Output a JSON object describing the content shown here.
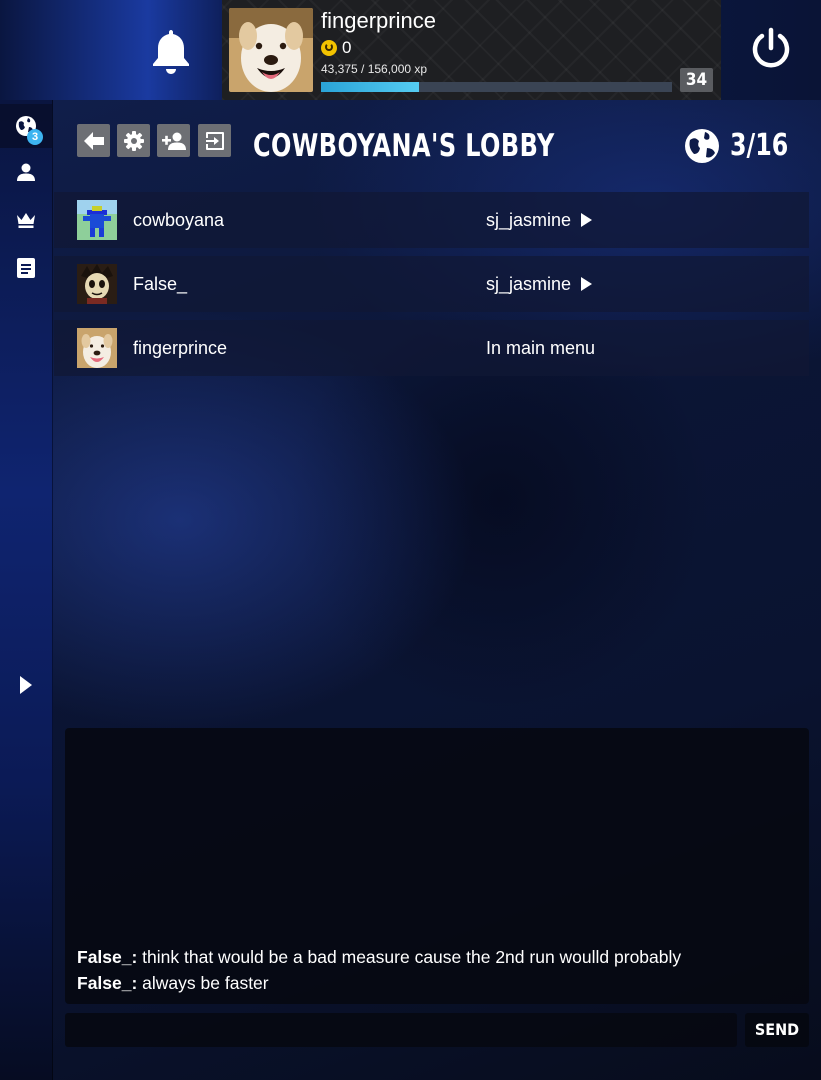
{
  "header": {
    "username": "fingerprince",
    "coins": "0",
    "xp_text": "43,375 / 156,000 xp",
    "xp_progress": 0.278,
    "level": "34",
    "colors": {
      "xp_bar": "#55ccf2",
      "coin": "#f3c300"
    },
    "icons": [
      "bell-icon",
      "power-icon",
      "coin-icon"
    ]
  },
  "sidebar": {
    "items": [
      {
        "icon": "globe-icon",
        "badge": "3",
        "active": true
      },
      {
        "icon": "person-icon"
      },
      {
        "icon": "crown-icon"
      },
      {
        "icon": "document-icon"
      }
    ],
    "expand_icon": "chevron-right-icon"
  },
  "lobby": {
    "title": "COWBOYANA'S LOBBY",
    "player_count": "3/16",
    "toolbar_icons": [
      "back-arrow-icon",
      "settings-icon",
      "add-friend-icon",
      "exit-icon"
    ],
    "players": [
      {
        "name": "cowboyana",
        "status": "sj_jasmine",
        "has_play": true
      },
      {
        "name": "False_",
        "status": "sj_jasmine",
        "has_play": true
      },
      {
        "name": "fingerprince",
        "status": "In main menu",
        "has_play": false
      }
    ]
  },
  "chat": {
    "messages": [
      {
        "author": "False_:",
        "text": " think that would be a bad measure cause the 2nd run woulld probably"
      },
      {
        "author": "False_:",
        "text": " always be faster"
      }
    ],
    "input_value": "",
    "send_label": "SEND"
  }
}
